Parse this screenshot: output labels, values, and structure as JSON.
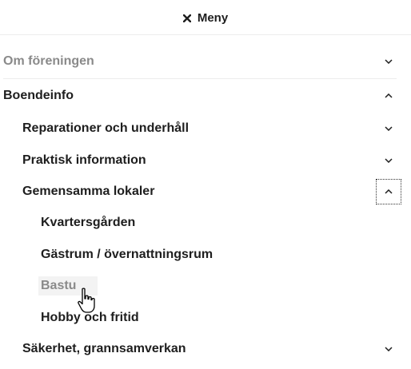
{
  "menu": {
    "close_label": "Meny",
    "close_icon": "close-icon"
  },
  "nav": {
    "om_foreningen": {
      "label": "Om föreningen",
      "expanded": false
    },
    "boendeinfo": {
      "label": "Boendeinfo",
      "expanded": true,
      "children": {
        "reparationer": {
          "label": "Reparationer och underhåll",
          "expanded": false
        },
        "praktisk": {
          "label": "Praktisk information",
          "expanded": false
        },
        "gemensamma": {
          "label": "Gemensamma lokaler",
          "expanded": true,
          "children": [
            {
              "label": "Kvartersgården"
            },
            {
              "label": "Gästrum / övernattningsrum"
            },
            {
              "label": "Bastu",
              "hovered": true
            },
            {
              "label": "Hobby och fritid"
            }
          ]
        },
        "sakerhet": {
          "label": "Säkerhet, grannsamverkan",
          "expanded": false
        }
      }
    }
  },
  "colors": {
    "text": "#1e1e1e",
    "muted": "#8a8a8a",
    "divider": "#ececec"
  }
}
